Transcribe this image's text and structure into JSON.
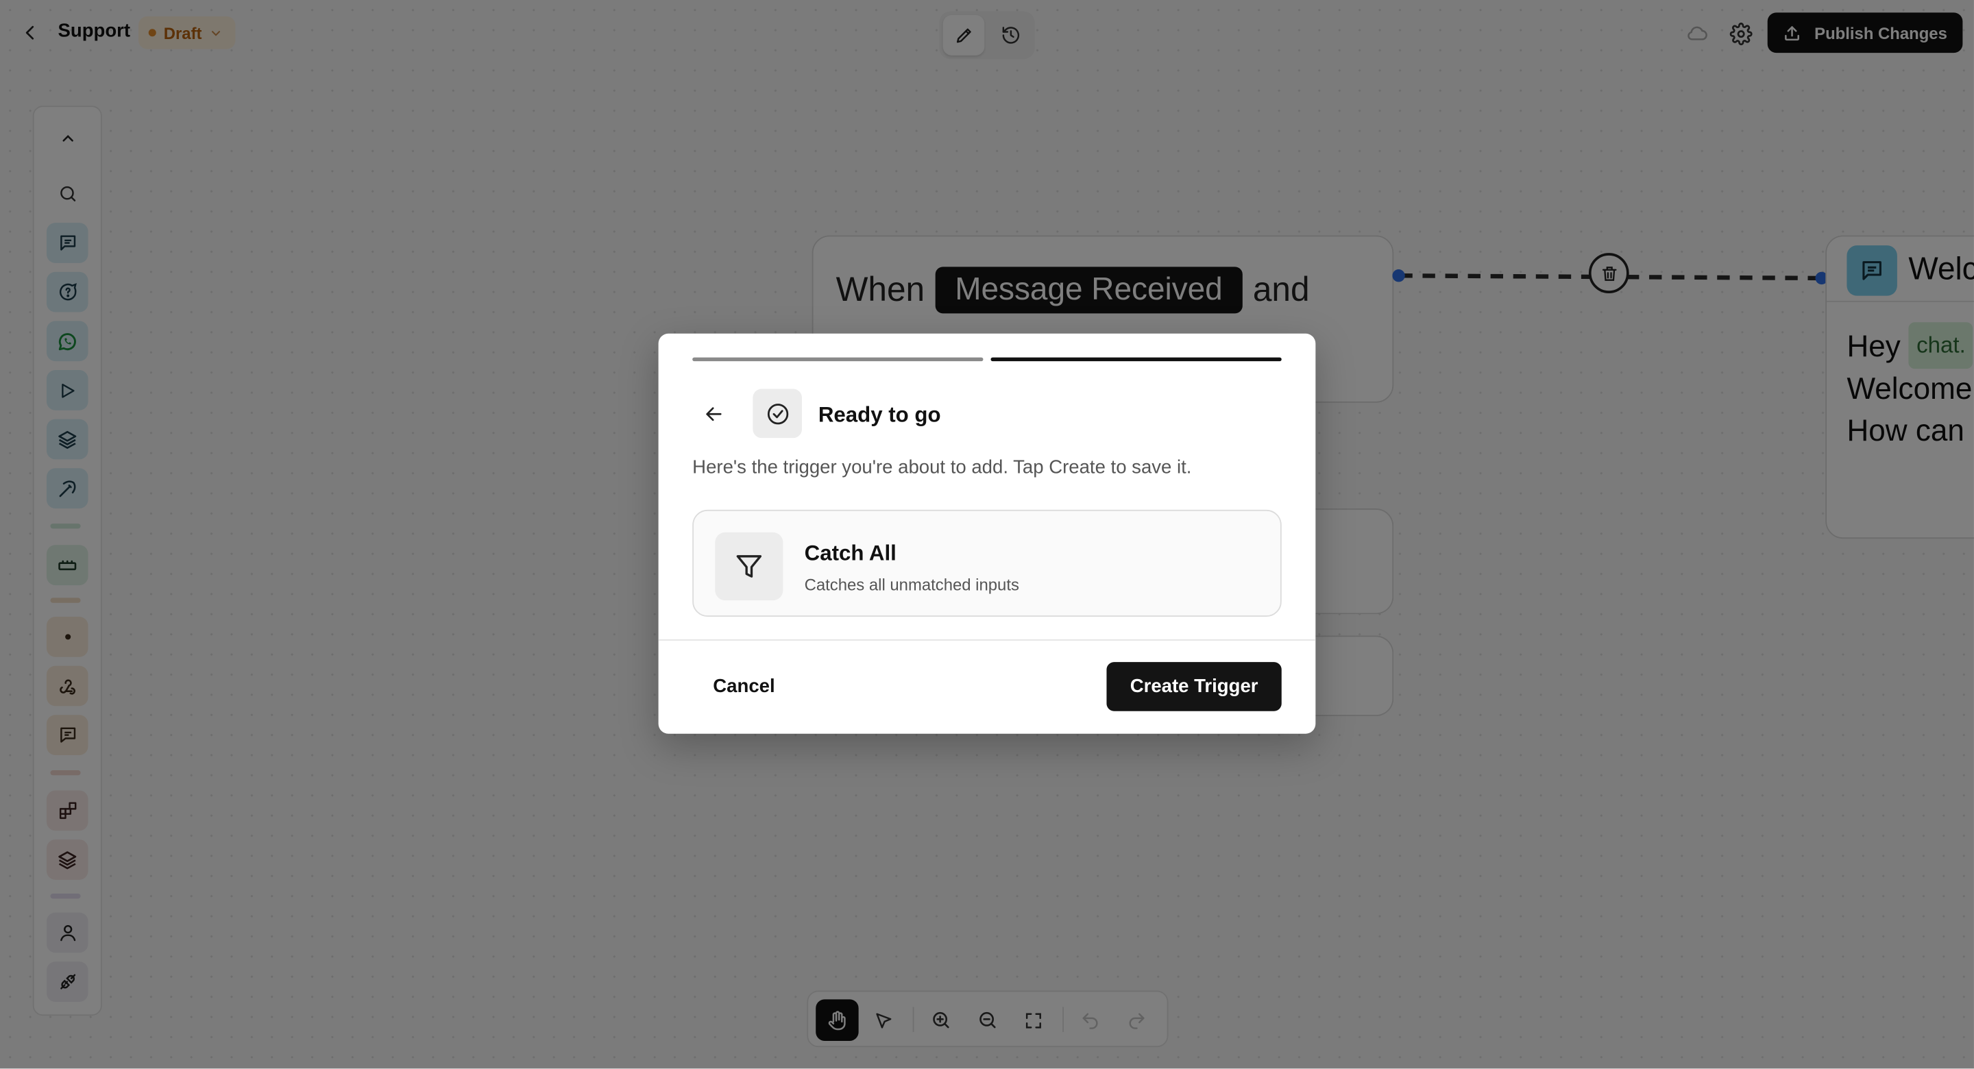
{
  "header": {
    "title": "Support",
    "status": "Draft",
    "publish_label": "Publish Changes"
  },
  "canvas": {
    "trigger_node": {
      "prefix": "When",
      "event": "Message Received",
      "suffix": "and"
    },
    "welcome_node": {
      "title": "Welc",
      "line1_word": "Hey",
      "line1_var": "chat.",
      "line2": "Welcome",
      "line3": "How can"
    }
  },
  "modal": {
    "steps_total": 2,
    "steps_completed": 2,
    "title": "Ready to go",
    "description": "Here's the trigger you're about to add. Tap Create to save it.",
    "trigger": {
      "name": "Catch All",
      "description": "Catches all unmatched inputs"
    },
    "cancel_label": "Cancel",
    "create_label": "Create Trigger"
  },
  "sidebar": {
    "items": [
      "chevron-up-icon",
      "search-icon",
      "message-icon",
      "chat-help-icon",
      "whatsapp-icon",
      "play-icon",
      "layers-icon",
      "pickaxe-icon",
      "keyboard-icon",
      "dot-icon",
      "webhook-icon",
      "chat-square-icon",
      "blocks-icon",
      "layers-icon",
      "user-icon",
      "plug-icon"
    ]
  },
  "colors": {
    "accent": "#111111",
    "draft": "#b8620e",
    "draft_bg": "#fdf0dc",
    "edge_dot": "#2f6fe4",
    "welcome_icon_bg": "#7fd0ee",
    "var_chip_bg": "#d7f0d9"
  }
}
